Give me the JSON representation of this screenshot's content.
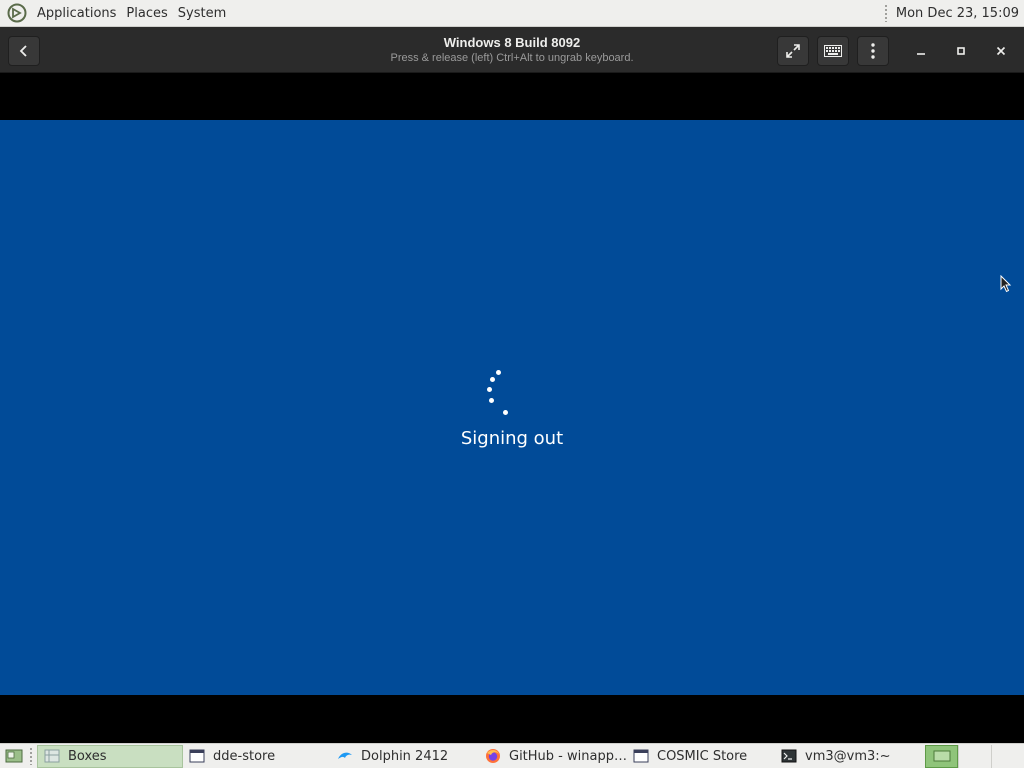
{
  "top_panel": {
    "menus": [
      "Applications",
      "Places",
      "System"
    ],
    "clock": "Mon Dec 23, 15:09"
  },
  "window": {
    "title": "Windows 8 Build 8092",
    "subtitle": "Press & release (left) Ctrl+Alt to ungrab keyboard."
  },
  "vm_screen": {
    "status_text": "Signing out",
    "background_color": "#014b98"
  },
  "taskbar": {
    "tasks": [
      {
        "label": "Boxes",
        "icon": "boxes-icon",
        "active": true
      },
      {
        "label": "dde-store",
        "icon": "window-icon",
        "active": false
      },
      {
        "label": "Dolphin 2412",
        "icon": "dolphin-icon",
        "active": false
      },
      {
        "label": "GitHub - winapp…",
        "icon": "firefox-icon",
        "active": false
      },
      {
        "label": "COSMIC Store",
        "icon": "window-icon",
        "active": false
      },
      {
        "label": "vm3@vm3:~",
        "icon": "terminal-icon",
        "active": false
      }
    ],
    "workspace_count": 3,
    "active_workspace": 1
  }
}
